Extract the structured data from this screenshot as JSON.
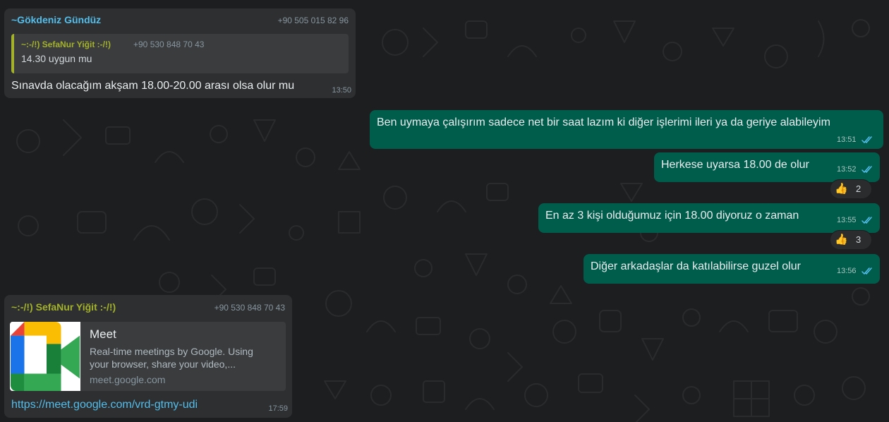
{
  "colors": {
    "background": "#1d1e1f",
    "incoming_bubble": "#2e2f30",
    "outgoing_bubble": "#005c4b",
    "sender_blue": "#53bdeb",
    "sender_olive": "#a3b22a",
    "read_ticks": "#53bdeb"
  },
  "messages": [
    {
      "sender": "~Gökdeniz Gündüz",
      "phone": "+90 505 015 82 96",
      "quote": {
        "sender": "~:-/!) SefaNur Yiğit :-/!)",
        "phone": "+90 530 848 70 43",
        "text": "14.30 uygun mu"
      },
      "text": "Sınavda olacağım akşam 18.00-20.00 arası olsa olur mu",
      "time": "13:50"
    },
    {
      "text": "Ben uymaya çalışırım sadece net bir saat lazım ki diğer işlerimi ileri ya da geriye alabileyim",
      "time": "13:51"
    },
    {
      "text": "Herkese uyarsa 18.00 de olur",
      "time": "13:52",
      "reaction": {
        "emoji": "👍",
        "count": "2"
      }
    },
    {
      "text": "En az 3 kişi olduğumuz için 18.00 diyoruz o zaman",
      "time": "13:55",
      "reaction": {
        "emoji": "👍",
        "count": "3"
      }
    },
    {
      "text": "Diğer arkadaşlar da katılabilirse guzel olur",
      "time": "13:56"
    },
    {
      "sender": "~:-/!) SefaNur Yiğit :-/!)",
      "phone": "+90 530 848 70 43",
      "preview": {
        "title": "Meet",
        "description_line1": "Real-time meetings by Google. Using",
        "description_line2": "your browser, share your video,...",
        "domain": "meet.google.com"
      },
      "link": "https://meet.google.com/vrd-gtmy-udi",
      "time": "17:59"
    }
  ]
}
